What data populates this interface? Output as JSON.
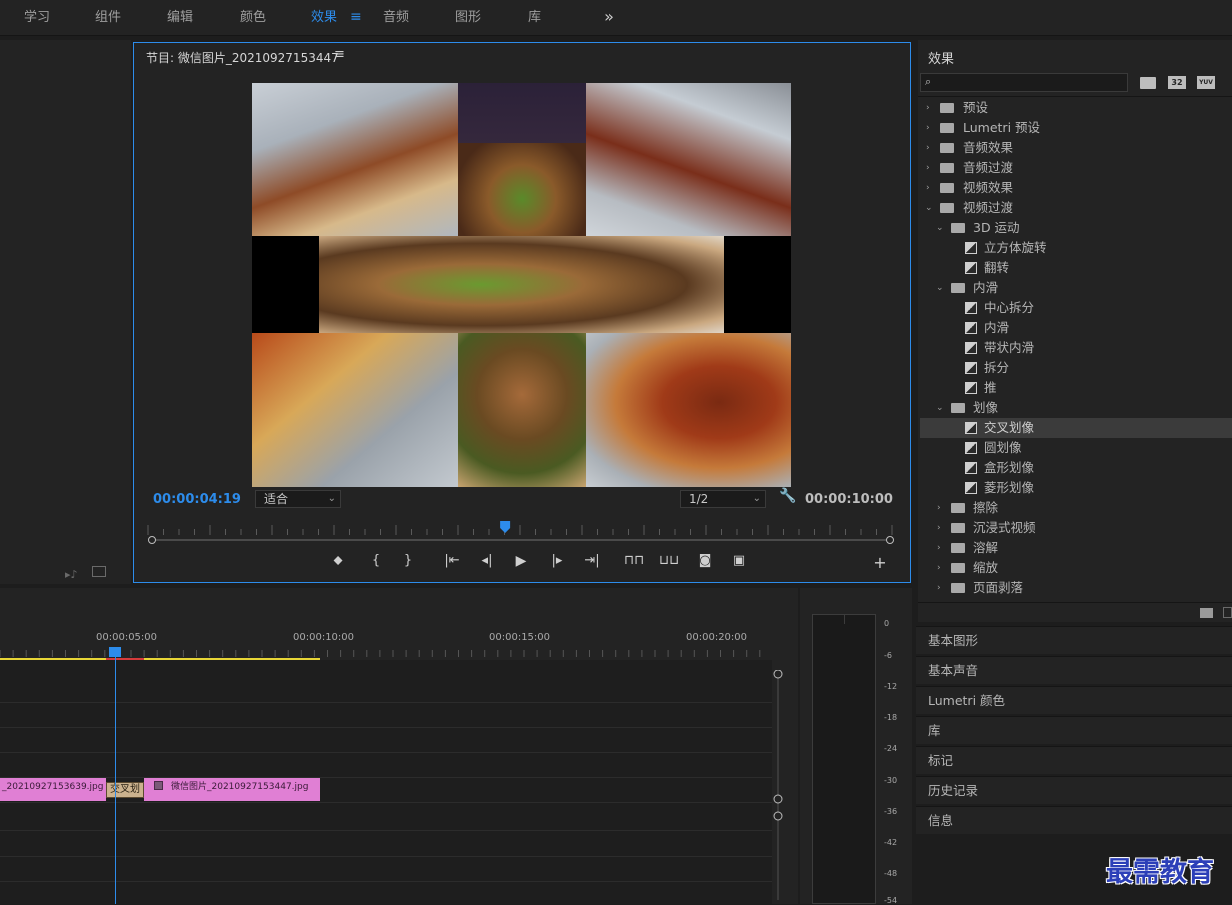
{
  "workspaces": [
    "学习",
    "组件",
    "编辑",
    "颜色",
    "效果",
    "音频",
    "图形",
    "库"
  ],
  "active_workspace": "效果",
  "workspace_menu_icon": "hamburger-icon",
  "more_icon": "double-chevron-right-icon",
  "program": {
    "title": "节目: 微信图片_20210927153447",
    "menu_icon": "≡",
    "current_time": "00:00:04:19",
    "zoom": "适合",
    "resolution": "1/2",
    "duration": "00:00:10:00",
    "playhead_fraction": 0.48
  },
  "timeline": {
    "ruler_labels": [
      "00:00:05:00",
      "00:00:10:00",
      "00:00:15:00",
      "00:00:20:00"
    ],
    "clip1_label": "_20210927153639.jpg",
    "transition_label": "交叉划",
    "clip2_label": "微信图片_20210927153447.jpg"
  },
  "meter": {
    "scale": [
      "0",
      "-6",
      "-12",
      "-18",
      "-24",
      "-30",
      "-36",
      "-42",
      "-48",
      "-54"
    ]
  },
  "effects": {
    "title": "效果",
    "search_placeholder": "",
    "tool_labels": [
      "32",
      "YUV"
    ],
    "tree": {
      "presets": "预设",
      "lumetri_presets": "Lumetri 预设",
      "audio_effects": "音频效果",
      "audio_transitions": "音频过渡",
      "video_effects": "视频效果",
      "video_transitions": "视频过渡",
      "motion3d": "3D 运动",
      "cube_spin": "立方体旋转",
      "flip": "翻转",
      "slide": "内滑",
      "center_split": "中心拆分",
      "slide_item": "内滑",
      "band_slide": "带状内滑",
      "split": "拆分",
      "push": "推",
      "iris": "划像",
      "iris_cross": "交叉划像",
      "iris_round": "圆划像",
      "iris_box": "盒形划像",
      "iris_diamond": "菱形划像",
      "wipe": "擦除",
      "immersive": "沉浸式视频",
      "dissolve": "溶解",
      "zoom": "缩放",
      "page_peel": "页面剥落"
    }
  },
  "side_panels": [
    "基本图形",
    "基本声音",
    "Lumetri 颜色",
    "库",
    "标记",
    "历史记录",
    "信息"
  ],
  "watermark": "最需教育",
  "colors": {
    "accent": "#2d8ceb",
    "clip": "#e07fd4",
    "bg": "#232323"
  }
}
